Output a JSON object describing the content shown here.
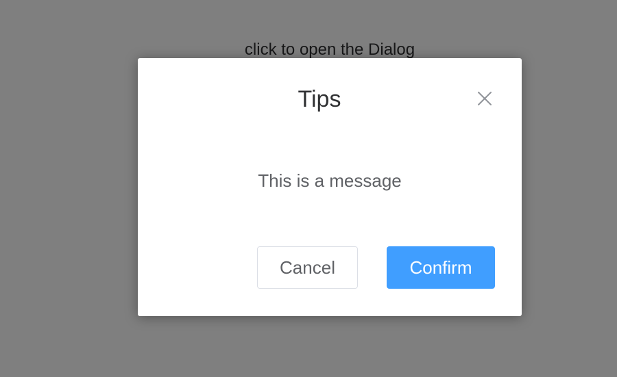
{
  "page": {
    "open_link_label": "click to open the Dialog"
  },
  "dialog": {
    "title": "Tips",
    "message": "This is a message",
    "close_icon": "close-icon",
    "cancel_label": "Cancel",
    "confirm_label": "Confirm"
  },
  "colors": {
    "overlay": "#808080",
    "primary": "#409eff",
    "text_primary": "#303133",
    "text_regular": "#606266",
    "border": "#dcdfe6"
  }
}
